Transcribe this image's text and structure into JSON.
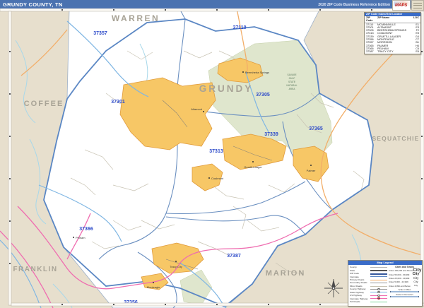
{
  "header": {
    "title": "GRUNDY COUNTY, TN",
    "edition": "2020 ZIP Code Business Reference Edition",
    "logo": "MAPS"
  },
  "zip_table": {
    "title": "ZIP Code Index/Grid Locator",
    "col_zip": "ZIP Code",
    "col_name": "ZIP Name",
    "col_loc": "LOC",
    "rows": [
      {
        "zip": "37110",
        "name": "MCMINNVILLE",
        "loc": "E1"
      },
      {
        "zip": "37301",
        "name": "ALTAMONT",
        "loc": "E3"
      },
      {
        "zip": "37305",
        "name": "BEERSHEBA SPRINGS",
        "loc": "F2"
      },
      {
        "zip": "37313",
        "name": "COALMONT",
        "loc": "E5"
      },
      {
        "zip": "37339",
        "name": "GRUETLI-LAAGER",
        "loc": "G4"
      },
      {
        "zip": "37356",
        "name": "MONTEAGLE",
        "loc": "C7"
      },
      {
        "zip": "37357",
        "name": "MORRISON",
        "loc": "B1"
      },
      {
        "zip": "37365",
        "name": "PALMER",
        "loc": "H4"
      },
      {
        "zip": "37366",
        "name": "PELHAM",
        "loc": "C6"
      },
      {
        "zip": "37387",
        "name": "TRACY CITY",
        "loc": "E6"
      }
    ]
  },
  "map": {
    "county": "GRUNDY",
    "neighbors": {
      "warren": "WARREN",
      "coffee": "COFFEE",
      "sequatchie": "SEQUATCHIE",
      "franklin": "FRANKLIN",
      "marion": "MARION"
    },
    "zips": [
      {
        "code": "37357"
      },
      {
        "code": "37110"
      },
      {
        "code": "37305"
      },
      {
        "code": "37301"
      },
      {
        "code": "37365"
      },
      {
        "code": "37339"
      },
      {
        "code": "37313"
      },
      {
        "code": "37366"
      },
      {
        "code": "37387"
      },
      {
        "code": "37356"
      }
    ],
    "towns": [
      {
        "name": "Beersheba Springs"
      },
      {
        "name": "Altamont"
      },
      {
        "name": "Coalmont"
      },
      {
        "name": "Gruetli-Laager"
      },
      {
        "name": "Palmer"
      },
      {
        "name": "Tracy City"
      },
      {
        "name": "Monteagle"
      },
      {
        "name": "Pelham"
      }
    ],
    "park": [
      "SAVAGE",
      "GULF",
      "STATE",
      "NATURAL",
      "AREA"
    ]
  },
  "legend": {
    "title": "Map Legend",
    "items": [
      {
        "label": "County"
      },
      {
        "label": "State"
      },
      {
        "label": "ZIP Code"
      },
      {
        "label": "Interstate"
      },
      {
        "label": "Primary Roads"
      },
      {
        "label": "Secondary Roads"
      },
      {
        "label": "Minor Roads"
      },
      {
        "label": "County Highway"
      },
      {
        "label": "State Highway"
      },
      {
        "label": "US Highway"
      },
      {
        "label": "Interstate Highway"
      },
      {
        "label": "Toll Roads"
      }
    ],
    "cities_title": "Cities and Towns",
    "city_classes": [
      {
        "label": "Cities 100,000 and Above",
        "sample": "City"
      },
      {
        "label": "Cities 50,000 - 99,999",
        "sample": "City"
      },
      {
        "label": "Cities 25,000 - 49,999",
        "sample": "City"
      },
      {
        "label": "Cities 5,000 - 24,999",
        "sample": "City"
      },
      {
        "label": "Cities 4,999 and Below",
        "sample": "City"
      }
    ],
    "scale_miles": "Scale in Miles",
    "scale_km": "Scale in Kilometers"
  },
  "colors": {
    "header_blue": "#4a72b0",
    "table_header_blue": "#3a6cc8",
    "outer_county_tan": "#e7dfcd",
    "county_interior": "#ffffff",
    "park_green": "#dfe6cd",
    "city_area_orange": "#f7c766",
    "city_area_border": "#e09b3d",
    "zip_boundary_blue": "#6a8fc0",
    "zip_label_blue": "#2b49c9",
    "us_highway_pink": "#ef6db0",
    "primary_road_orange": "#f2ae69",
    "state_highway_blue": "#7fb6e3",
    "stream_cyan": "#a8d8ea",
    "county_name_gray": "#a8a396"
  }
}
